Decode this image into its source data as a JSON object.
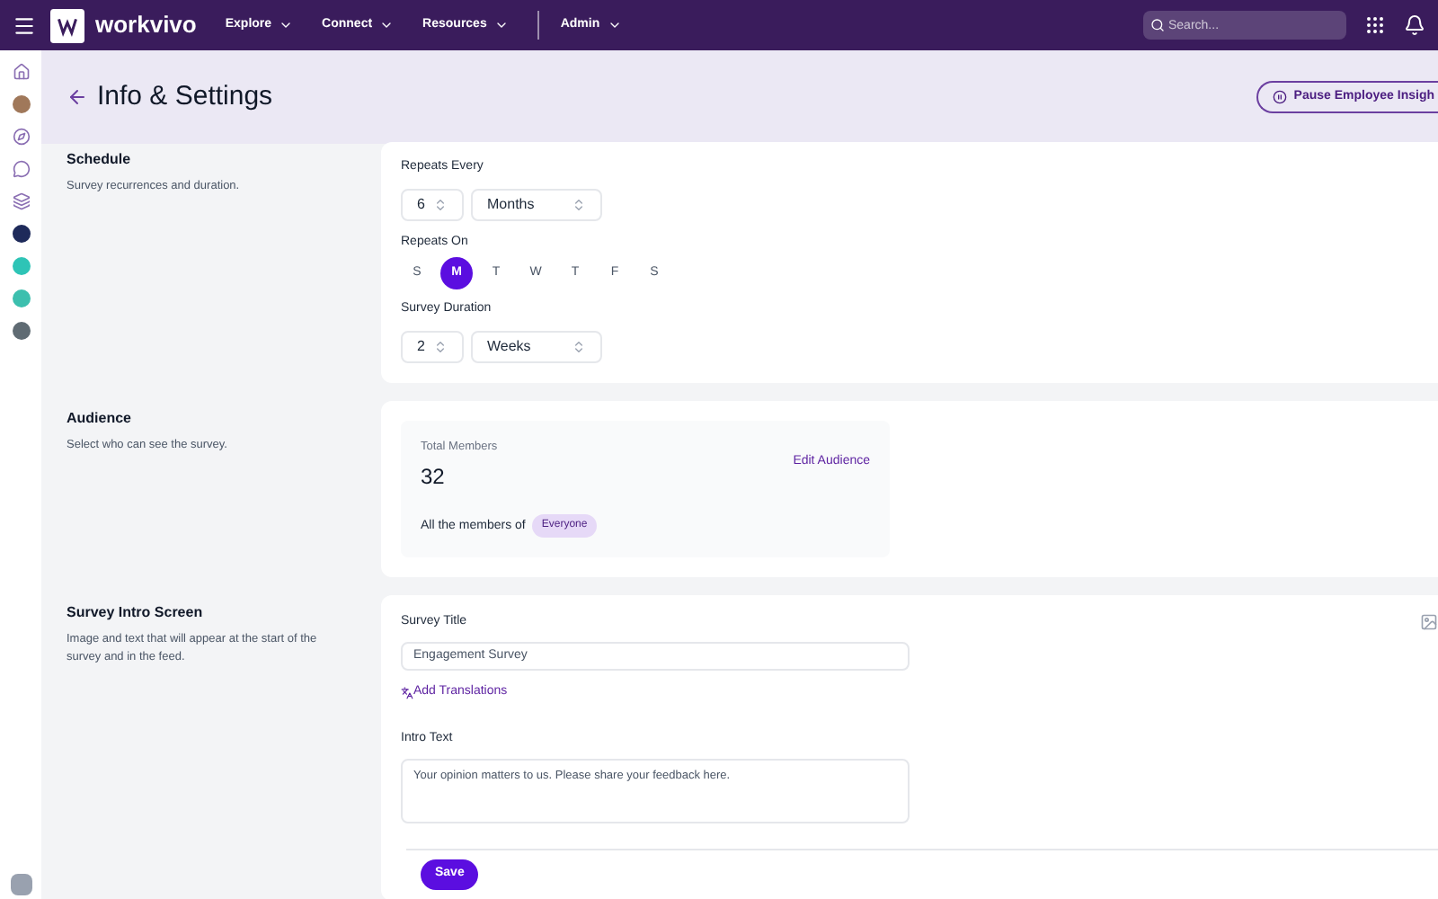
{
  "topbar": {
    "brand": "workvivo",
    "nav": [
      {
        "label": "Explore"
      },
      {
        "label": "Connect"
      },
      {
        "label": "Resources"
      },
      {
        "label": "Admin"
      }
    ],
    "search": {
      "placeholder": "Search..."
    }
  },
  "rail": {
    "apps": [
      {
        "color": "#1e2a5a"
      },
      {
        "color": "#2ec4b6"
      },
      {
        "color": "#3cbfae"
      },
      {
        "color": "#5f6b73"
      }
    ]
  },
  "header": {
    "title": "Info & Settings",
    "action": "Pause Employee Insigh"
  },
  "schedule": {
    "title": "Schedule",
    "description": "Survey recurrences and duration.",
    "repeats_label": "Repeats Every",
    "repeats_count": "6",
    "repeats_unit": "Months",
    "repeats_on_label": "Repeats On",
    "days": [
      {
        "label": "S",
        "selected": false
      },
      {
        "label": "M",
        "selected": true
      },
      {
        "label": "T",
        "selected": false
      },
      {
        "label": "W",
        "selected": false
      },
      {
        "label": "T",
        "selected": false
      },
      {
        "label": "F",
        "selected": false
      },
      {
        "label": "S",
        "selected": false
      }
    ],
    "duration_label": "Survey Duration",
    "duration_count": "2",
    "duration_unit": "Weeks"
  },
  "audience": {
    "title": "Audience",
    "description": "Select who can see the survey.",
    "total_label": "Total Members",
    "total": "32",
    "edit": "Edit Audience",
    "members_text": "All the members of",
    "group": "Everyone"
  },
  "intro": {
    "title": "Survey Intro Screen",
    "description": "Image and text that will appear at the start of the survey and in the feed.",
    "survey_title_label": "Survey Title",
    "survey_title": "Engagement Survey",
    "translations": "Add Translations",
    "intro_label": "Intro Text",
    "intro_text": "Your opinion matters to us. Please share your feedback here."
  },
  "footer": {
    "save": "Save"
  }
}
